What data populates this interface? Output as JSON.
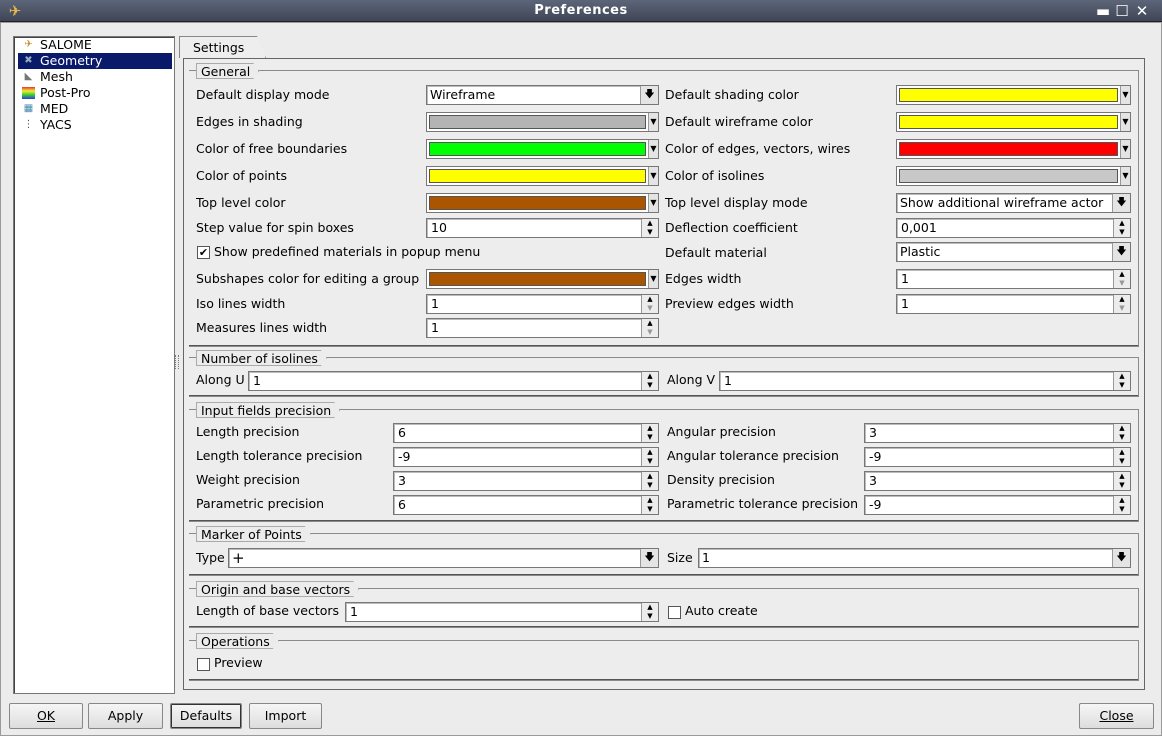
{
  "window": {
    "title": "Preferences",
    "buttons": {
      "minimize": "▬",
      "maximize": "☐",
      "close": "✕"
    }
  },
  "tree": {
    "items": [
      {
        "label": "SALOME",
        "icon": "salome-icon"
      },
      {
        "label": "Geometry",
        "icon": "geometry-icon",
        "selected": true
      },
      {
        "label": "Mesh",
        "icon": "mesh-icon"
      },
      {
        "label": "Post-Pro",
        "icon": "postpro-icon"
      },
      {
        "label": "MED",
        "icon": "med-icon"
      },
      {
        "label": "YACS",
        "icon": "yacs-icon"
      }
    ]
  },
  "tab": {
    "label": "Settings"
  },
  "general": {
    "title": "General",
    "default_display_mode": {
      "label": "Default display mode",
      "value": "Wireframe"
    },
    "edges_in_shading": {
      "label": "Edges in shading",
      "color": "#b4b4b4"
    },
    "free_boundaries": {
      "label": "Color of free boundaries",
      "color": "#00ff00"
    },
    "color_points": {
      "label": "Color of points",
      "color": "#ffff00"
    },
    "top_level_color": {
      "label": "Top level color",
      "color": "#aa5500"
    },
    "step_value": {
      "label": "Step value for spin boxes",
      "value": "10"
    },
    "show_materials": {
      "label": "Show predefined materials in popup menu",
      "checked": "✔"
    },
    "subshapes_color": {
      "label": "Subshapes color for editing a group",
      "color": "#aa5500"
    },
    "iso_lines_width": {
      "label": "Iso lines width",
      "value": "1"
    },
    "measures_lines_width": {
      "label": "Measures lines width",
      "value": "1"
    },
    "default_shading_color": {
      "label": "Default shading color",
      "color": "#ffff00"
    },
    "default_wireframe_color": {
      "label": "Default wireframe color",
      "color": "#ffff00"
    },
    "edges_vectors_wires": {
      "label": "Color of edges, vectors, wires",
      "color": "#ff0000"
    },
    "color_isolines": {
      "label": "Color of isolines",
      "color": "#c8c8c8"
    },
    "top_level_display_mode": {
      "label": "Top level display mode",
      "value": "Show additional wireframe actor"
    },
    "deflection": {
      "label": "Deflection coefficient",
      "value": "0,001"
    },
    "default_material": {
      "label": "Default material",
      "value": "Plastic"
    },
    "edges_width": {
      "label": "Edges width",
      "value": "1"
    },
    "preview_edges_width": {
      "label": "Preview edges width",
      "value": "1"
    }
  },
  "isolines": {
    "title": "Number of isolines",
    "along_u": {
      "label": "Along U",
      "value": "1"
    },
    "along_v": {
      "label": "Along V",
      "value": "1"
    }
  },
  "precision": {
    "title": "Input fields precision",
    "length": {
      "label": "Length precision",
      "value": "6"
    },
    "length_tol": {
      "label": "Length tolerance precision",
      "value": "-9"
    },
    "weight": {
      "label": "Weight precision",
      "value": "3"
    },
    "parametric": {
      "label": "Parametric precision",
      "value": "6"
    },
    "angular": {
      "label": "Angular precision",
      "value": "3"
    },
    "angular_tol": {
      "label": "Angular tolerance precision",
      "value": "-9"
    },
    "density": {
      "label": "Density precision",
      "value": "3"
    },
    "parametric_tol": {
      "label": "Parametric tolerance precision",
      "value": "-9"
    }
  },
  "marker": {
    "title": "Marker of Points",
    "type": {
      "label": "Type",
      "value": "+"
    },
    "size": {
      "label": "Size",
      "value": "1"
    }
  },
  "origin": {
    "title": "Origin and base vectors",
    "length": {
      "label": "Length of base vectors",
      "value": "1"
    },
    "auto_create": {
      "label": "Auto create",
      "checked": ""
    }
  },
  "operations": {
    "title": "Operations",
    "preview": {
      "label": "Preview",
      "checked": ""
    }
  },
  "buttons": {
    "ok": "OK",
    "apply": "Apply",
    "defaults": "Defaults",
    "import": "Import",
    "close": "Close"
  }
}
